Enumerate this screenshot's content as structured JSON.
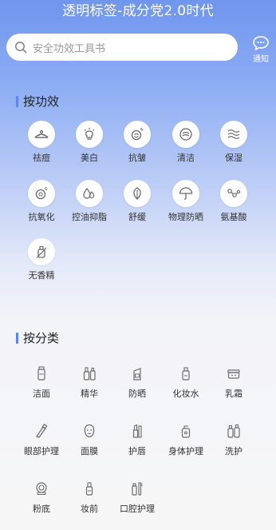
{
  "header": {
    "title": "透明标签-成分党2.0时代"
  },
  "search": {
    "placeholder": "安全功效工具书"
  },
  "notify": {
    "label": "通知"
  },
  "colors": {
    "accent": "#5b87ea",
    "icon": "#6b6b6b"
  },
  "efficacy": {
    "title": "按功效",
    "items": [
      {
        "label": "祛痘",
        "icon": "acne-icon"
      },
      {
        "label": "美白",
        "icon": "whitening-icon"
      },
      {
        "label": "抗皱",
        "icon": "anti-wrinkle-icon"
      },
      {
        "label": "清洁",
        "icon": "cleansing-icon"
      },
      {
        "label": "保湿",
        "icon": "moisturizing-icon"
      },
      {
        "label": "抗氧化",
        "icon": "antioxidant-icon"
      },
      {
        "label": "控油抑脂",
        "icon": "oil-control-icon"
      },
      {
        "label": "舒缓",
        "icon": "soothing-icon"
      },
      {
        "label": "物理防晒",
        "icon": "umbrella-icon"
      },
      {
        "label": "氨基酸",
        "icon": "amino-acid-icon"
      },
      {
        "label": "无香精",
        "icon": "fragrance-free-icon"
      }
    ]
  },
  "category": {
    "title": "按分类",
    "items": [
      {
        "label": "洁面",
        "icon": "cleanser-icon"
      },
      {
        "label": "精华",
        "icon": "essence-icon"
      },
      {
        "label": "防晒",
        "icon": "sunscreen-icon"
      },
      {
        "label": "化妆水",
        "icon": "toner-icon"
      },
      {
        "label": "乳霜",
        "icon": "cream-icon"
      },
      {
        "label": "眼部护理",
        "icon": "eye-care-icon"
      },
      {
        "label": "面膜",
        "icon": "mask-icon"
      },
      {
        "label": "护唇",
        "icon": "lip-care-icon"
      },
      {
        "label": "身体护理",
        "icon": "body-care-icon"
      },
      {
        "label": "洗护",
        "icon": "hair-care-icon"
      },
      {
        "label": "粉底",
        "icon": "foundation-icon"
      },
      {
        "label": "妆前",
        "icon": "primer-icon"
      },
      {
        "label": "口腔护理",
        "icon": "oral-care-icon"
      }
    ]
  }
}
